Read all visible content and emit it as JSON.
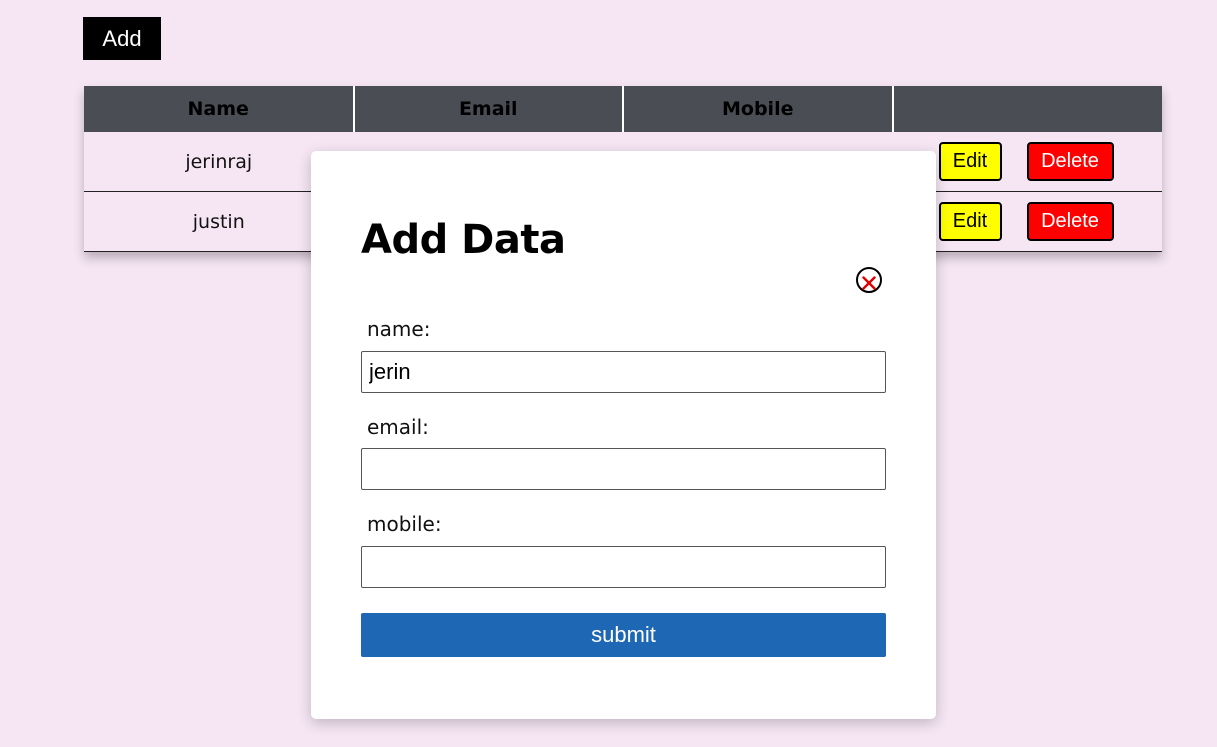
{
  "toolbar": {
    "add_label": "Add"
  },
  "table": {
    "headers": [
      "Name",
      "Email",
      "Mobile",
      ""
    ],
    "rows": [
      {
        "name": "jerinraj",
        "email": "",
        "mobile": "",
        "edit_label": "Edit",
        "delete_label": "Delete"
      },
      {
        "name": "justin",
        "email": "",
        "mobile": "",
        "edit_label": "Edit",
        "delete_label": "Delete"
      }
    ]
  },
  "modal": {
    "title": "Add Data",
    "close_icon": "close-circle-icon",
    "fields": [
      {
        "label": "name:",
        "value": "jerin"
      },
      {
        "label": "email:",
        "value": ""
      },
      {
        "label": "mobile:",
        "value": ""
      }
    ],
    "submit_label": "submit"
  },
  "colors": {
    "page_bg": "#f6e6f4",
    "header_bg": "#4a4e54",
    "edit_bg": "#ffff00",
    "delete_bg": "#ff0000",
    "submit_bg": "#1e67b4",
    "close_x": "#e00000"
  }
}
